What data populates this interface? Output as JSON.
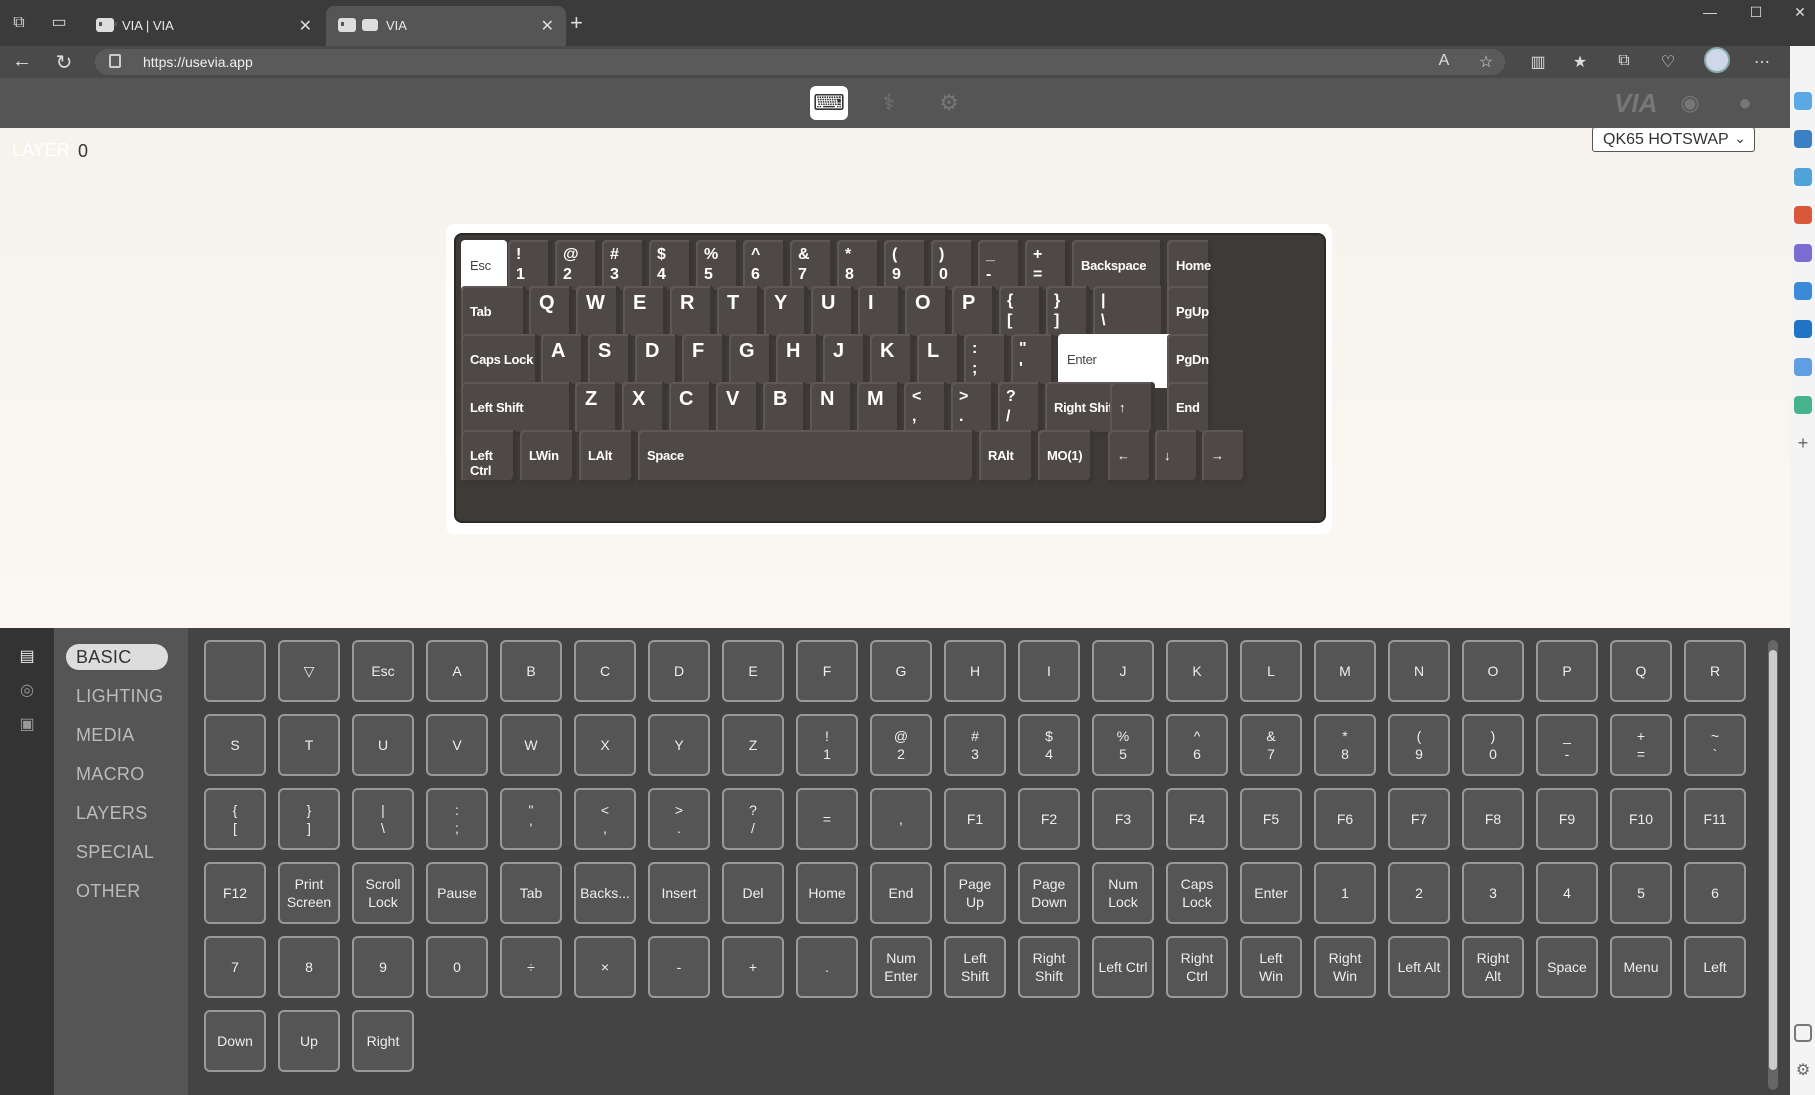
{
  "browser": {
    "tabs": [
      {
        "title": "VIA | VIA",
        "active": false
      },
      {
        "title": "VIA",
        "active": true
      }
    ],
    "url": "https://usevia.app",
    "close_glyph": "✕",
    "new_tab_glyph": "+",
    "window": {
      "minimize": "—",
      "maximize": "☐",
      "close": "✕"
    }
  },
  "app": {
    "brand": "VIA",
    "modes": [
      "keyboard-icon",
      "stethoscope-icon",
      "gear-icon"
    ],
    "layer_label": "LAYER",
    "layer_value": "0",
    "keyboard_name": "QK65 HOTSWAP",
    "accent": "#ffffff",
    "case_color": "#3e3a38",
    "keycap_color": "#4e4946"
  },
  "keyboard": {
    "rows": [
      [
        {
          "t": "",
          "b": "Esc",
          "sel": true
        },
        {
          "t": "!",
          "b": "1"
        },
        {
          "t": "@",
          "b": "2"
        },
        {
          "t": "#",
          "b": "3"
        },
        {
          "t": "$",
          "b": "4"
        },
        {
          "t": "%",
          "b": "5"
        },
        {
          "t": "^",
          "b": "6"
        },
        {
          "t": "&",
          "b": "7"
        },
        {
          "t": "*",
          "b": "8"
        },
        {
          "t": "(",
          "b": "9"
        },
        {
          "t": ")",
          "b": "0"
        },
        {
          "t": "_",
          "b": "-"
        },
        {
          "t": "+",
          "b": "="
        },
        {
          "t": "",
          "b": "Backspace"
        },
        {
          "t": "",
          "b": "Home"
        }
      ],
      [
        {
          "t": "",
          "b": "Tab"
        },
        {
          "t": "Q",
          "b": ""
        },
        {
          "t": "W",
          "b": ""
        },
        {
          "t": "E",
          "b": ""
        },
        {
          "t": "R",
          "b": ""
        },
        {
          "t": "T",
          "b": ""
        },
        {
          "t": "Y",
          "b": ""
        },
        {
          "t": "U",
          "b": ""
        },
        {
          "t": "I",
          "b": ""
        },
        {
          "t": "O",
          "b": ""
        },
        {
          "t": "P",
          "b": ""
        },
        {
          "t": "{",
          "b": "["
        },
        {
          "t": "}",
          "b": "]"
        },
        {
          "t": "|",
          "b": "\\"
        },
        {
          "t": "",
          "b": "PgUp"
        }
      ],
      [
        {
          "t": "",
          "b": "Caps Lock"
        },
        {
          "t": "A",
          "b": ""
        },
        {
          "t": "S",
          "b": ""
        },
        {
          "t": "D",
          "b": ""
        },
        {
          "t": "F",
          "b": ""
        },
        {
          "t": "G",
          "b": ""
        },
        {
          "t": "H",
          "b": ""
        },
        {
          "t": "J",
          "b": ""
        },
        {
          "t": "K",
          "b": ""
        },
        {
          "t": "L",
          "b": ""
        },
        {
          "t": ":",
          "b": ";"
        },
        {
          "t": "\"",
          "b": "'"
        },
        {
          "t": "",
          "b": "Enter",
          "sel": true
        },
        {
          "t": "",
          "b": "PgDn"
        }
      ],
      [
        {
          "t": "",
          "b": "Left Shift"
        },
        {
          "t": "Z",
          "b": ""
        },
        {
          "t": "X",
          "b": ""
        },
        {
          "t": "C",
          "b": ""
        },
        {
          "t": "V",
          "b": ""
        },
        {
          "t": "B",
          "b": ""
        },
        {
          "t": "N",
          "b": ""
        },
        {
          "t": "M",
          "b": ""
        },
        {
          "t": "<",
          "b": ","
        },
        {
          "t": ">",
          "b": "."
        },
        {
          "t": "?",
          "b": "/"
        },
        {
          "t": "",
          "b": "Right Shift"
        },
        {
          "t": "",
          "b": "↑"
        },
        {
          "t": "",
          "b": "End"
        }
      ],
      [
        {
          "t": "",
          "b": "Left Ctrl"
        },
        {
          "t": "",
          "b": "LWin"
        },
        {
          "t": "",
          "b": "LAlt"
        },
        {
          "t": "",
          "b": "Space"
        },
        {
          "t": "",
          "b": "RAlt"
        },
        {
          "t": "",
          "b": "MO(1)"
        },
        {
          "t": "",
          "b": "←"
        },
        {
          "t": "",
          "b": "↓"
        },
        {
          "t": "",
          "b": "→"
        }
      ]
    ]
  },
  "menu": {
    "items": [
      "BASIC",
      "LIGHTING",
      "MEDIA",
      "MACRO",
      "LAYERS",
      "SPECIAL",
      "OTHER"
    ],
    "active": "BASIC"
  },
  "keycodes": [
    "",
    "▽",
    "Esc",
    "A",
    "B",
    "C",
    "D",
    "E",
    "F",
    "G",
    "H",
    "I",
    "J",
    "K",
    "L",
    "M",
    "N",
    "O",
    "P",
    "Q",
    "R",
    "S",
    "T",
    "U",
    "V",
    "W",
    "X",
    "Y",
    "Z",
    "!\n1",
    "@\n2",
    "#\n3",
    "$\n4",
    "%\n5",
    "^\n6",
    "&\n7",
    "*\n8",
    "(\n9",
    ")\n0",
    "_\n-",
    "+\n=",
    "~\n`",
    "{\n[",
    "}\n]",
    "|\n\\",
    ":\n;",
    "\"\n'",
    "<\n,",
    ">\n.",
    "?\n/",
    "=",
    ",",
    "F1",
    "F2",
    "F3",
    "F4",
    "F5",
    "F6",
    "F7",
    "F8",
    "F9",
    "F10",
    "F11",
    "F12",
    "Print\nScreen",
    "Scroll\nLock",
    "Pause",
    "Tab",
    "Backs...",
    "Insert",
    "Del",
    "Home",
    "End",
    "Page\nUp",
    "Page\nDown",
    "Num\nLock",
    "Caps\nLock",
    "Enter",
    "1",
    "2",
    "3",
    "4",
    "5",
    "6",
    "7",
    "8",
    "9",
    "0",
    "÷",
    "×",
    "-",
    "+",
    ".",
    "Num\nEnter",
    "Left\nShift",
    "Right\nShift",
    "Left Ctrl",
    "Right\nCtrl",
    "Left\nWin",
    "Right\nWin",
    "Left Alt",
    "Right\nAlt",
    "Space",
    "Menu",
    "Left",
    "Down",
    "Up",
    "Right"
  ]
}
